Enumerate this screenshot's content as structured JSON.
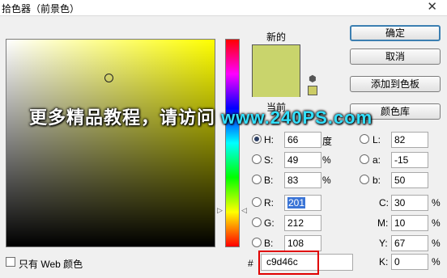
{
  "window": {
    "title": "拾色器（前景色）",
    "close": "✕"
  },
  "picker": {
    "new_label": "新的",
    "current_label": "当前",
    "new_color": "#c9d46c",
    "websafe_color": "#cccc66"
  },
  "buttons": {
    "ok": "确定",
    "cancel": "取消",
    "add_swatch": "添加到色板",
    "libraries": "颜色库"
  },
  "banner": {
    "text_cn": "更多精品教程，请访问 ",
    "text_site": "www.240PS.com"
  },
  "hsb": {
    "h": {
      "label": "H:",
      "value": "66",
      "unit": "度"
    },
    "s": {
      "label": "S:",
      "value": "49",
      "unit": "%"
    },
    "b": {
      "label": "B:",
      "value": "83",
      "unit": "%"
    }
  },
  "rgb": {
    "r": {
      "label": "R:",
      "value": "201"
    },
    "g": {
      "label": "G:",
      "value": "212"
    },
    "b": {
      "label": "B:",
      "value": "108"
    }
  },
  "lab": {
    "l": {
      "label": "L:",
      "value": "82"
    },
    "a": {
      "label": "a:",
      "value": "-15"
    },
    "b": {
      "label": "b:",
      "value": "50"
    }
  },
  "cmyk": {
    "c": {
      "label": "C:",
      "value": "30",
      "unit": "%"
    },
    "m": {
      "label": "M:",
      "value": "10",
      "unit": "%"
    },
    "y": {
      "label": "Y:",
      "value": "67",
      "unit": "%"
    },
    "k": {
      "label": "K:",
      "value": "0",
      "unit": "%"
    }
  },
  "hex": {
    "hash": "#",
    "value": "c9d46c"
  },
  "web_only": {
    "label": "只有 Web 颜色",
    "checked": false
  }
}
